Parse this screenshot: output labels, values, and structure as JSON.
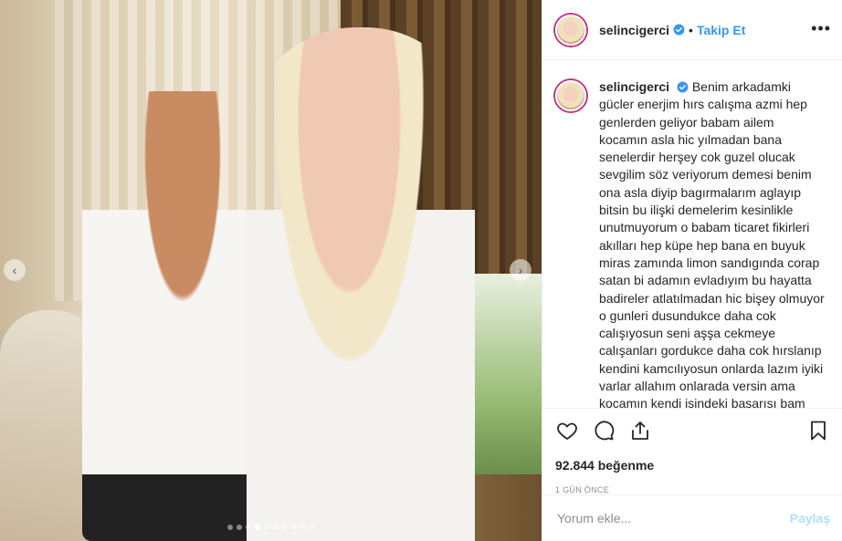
{
  "post": {
    "username": "selincigerci",
    "follow_label": "Takip Et",
    "separator": "•",
    "more_label": "•••",
    "verified_icon": "verified-badge-icon",
    "caption": "Benim arkadamki gücler enerjim hırs calışma azmi hep genlerden geliyor babam ailem kocamın asla hic yılmadan bana senelerdir herşey cok guzel olucak sevgilim söz veriyorum demesi benim ona asla diyip bagırmalarım aglayıp bitsin bu ilişki demelerim kesinlikle unutmuyorum o babam ticaret fikirleri akılları hep küpe hep bana en buyuk miras zamında limon sandıgında corap satan bi adamın evladıyım bu hayatta badireler atlatılmadan hic bişey olmuyor o gunleri dusundukce daha cok calışıyosun seni aşşa cekmeye calışanları gordukce daha cok hırslanıp kendini kamcılıyosun onlarda lazım iyiki varlar allahım onlarada versin ama kocamın kendi işindeki başarısı bam baska benım kestane sekerim ballı",
    "likes": "92.844 beğenme",
    "date": "1 GÜN ÖNCE"
  },
  "carousel": {
    "prev_label": "‹",
    "next_label": "›",
    "total": 10,
    "active_index": 3
  },
  "comment": {
    "placeholder": "Yorum ekle...",
    "post_label": "Paylaş"
  },
  "colors": {
    "link": "#3897f0",
    "post_disabled": "#b2dffc",
    "muted": "#8e8e8e",
    "text": "#262626",
    "story_ring": "#c13584"
  },
  "icons": [
    "heart-icon",
    "comment-icon",
    "share-icon",
    "bookmark-icon",
    "chevron-left-icon",
    "chevron-right-icon",
    "more-icon"
  ]
}
